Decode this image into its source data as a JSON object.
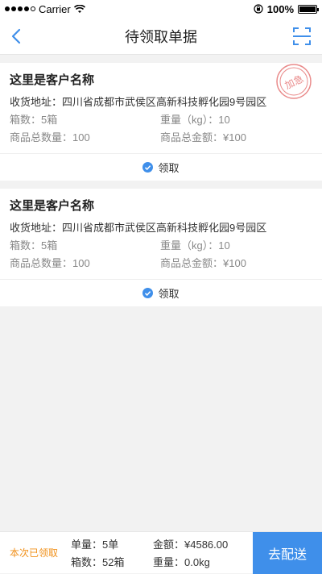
{
  "statusbar": {
    "carrier": "Carrier",
    "battery": "100%"
  },
  "navbar": {
    "title": "待领取单据"
  },
  "cards": [
    {
      "customer": "这里是客户名称",
      "address": "收货地址：四川省成都市武侯区高新科技孵化园9号园区",
      "boxes": "箱数：5箱",
      "weight": "重量（kg）：10",
      "qty": "商品总数量：100",
      "amount": "商品总金额：¥100",
      "action": "领取",
      "stamp": "加急"
    },
    {
      "customer": "这里是客户名称",
      "address": "收货地址：四川省成都市武侯区高新科技孵化园9号园区",
      "boxes": "箱数：5箱",
      "weight": "重量（kg）：10",
      "qty": "商品总数量：100",
      "amount": "商品总金额：¥100",
      "action": "领取"
    }
  ],
  "bottom": {
    "label": "本次已领取",
    "orders": "单量：5单",
    "boxes": "箱数：52箱",
    "amount": "金额：¥4586.00",
    "weight": "重量：0.0kg",
    "button": "去配送"
  },
  "colors": {
    "accent": "#3f8fea",
    "highlight": "#f0901a",
    "stamp": "#e98a8a"
  }
}
